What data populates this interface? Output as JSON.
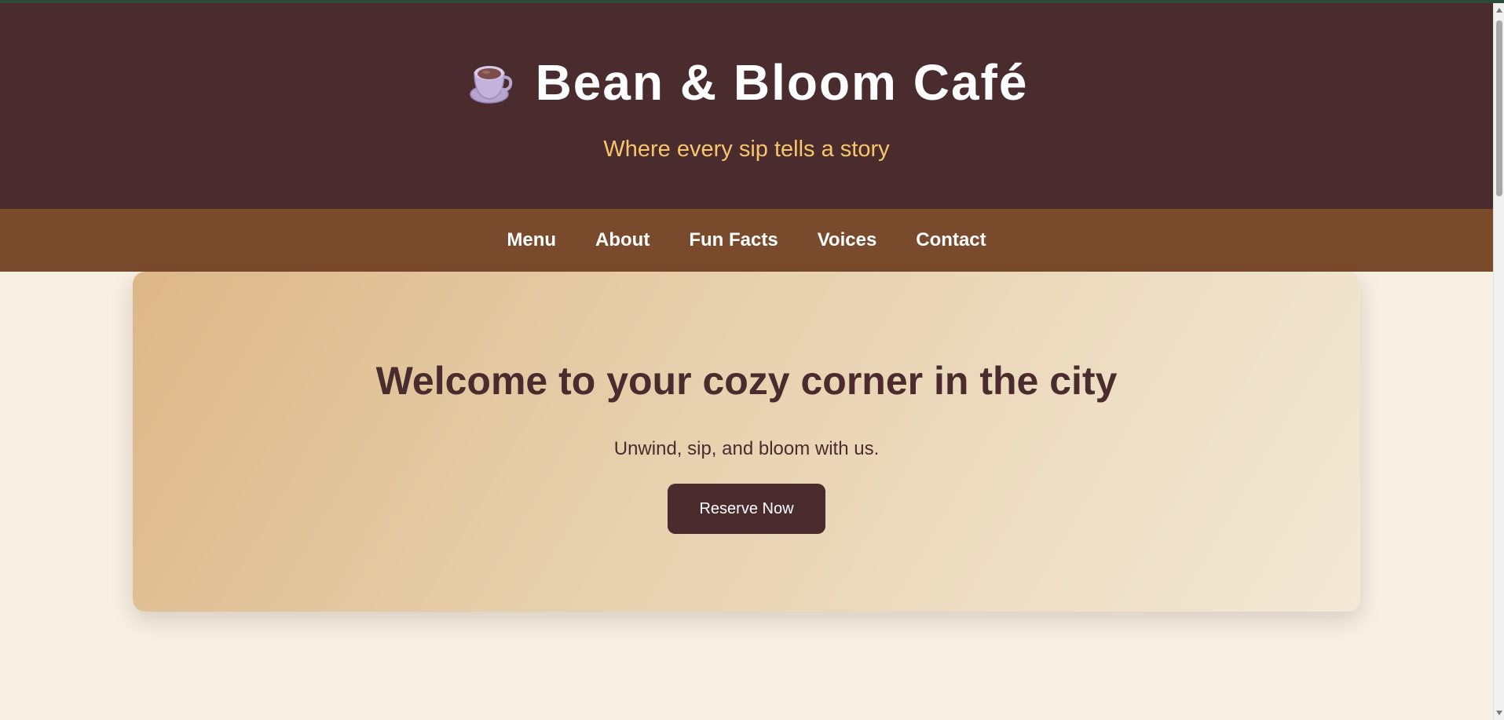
{
  "header": {
    "icon": "coffee-cup-icon",
    "title": "Bean & Bloom Café",
    "tagline": "Where every sip tells a story"
  },
  "nav": {
    "items": [
      {
        "label": "Menu"
      },
      {
        "label": "About"
      },
      {
        "label": "Fun Facts"
      },
      {
        "label": "Voices"
      },
      {
        "label": "Contact"
      }
    ]
  },
  "hero": {
    "title": "Welcome to your cozy corner in the city",
    "subtitle": "Unwind, sip, and bloom with us.",
    "button_label": "Reserve Now"
  },
  "colors": {
    "header_bg": "#4a2c2f",
    "nav_bg": "#7a4a2c",
    "tagline": "#f7c56b",
    "page_bg": "#f7f0e3",
    "button_bg": "#4a2c2f"
  }
}
